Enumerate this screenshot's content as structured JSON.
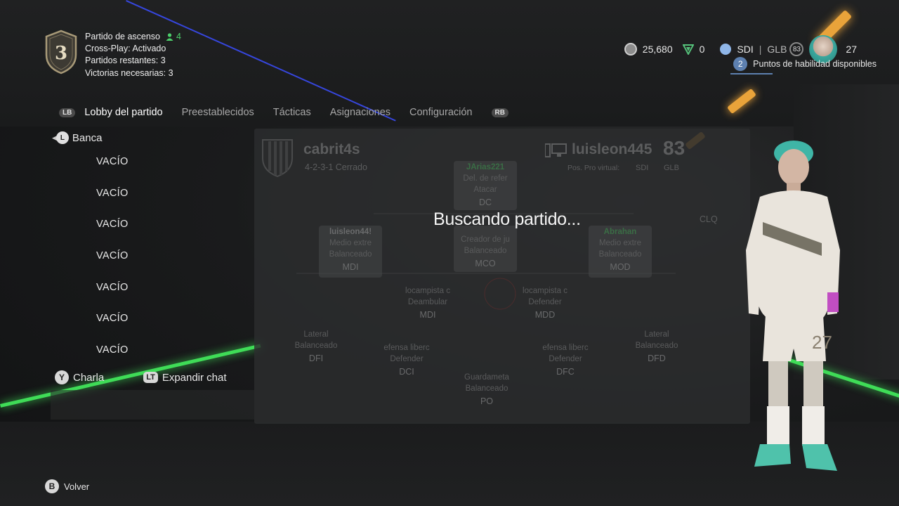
{
  "header": {
    "mode": "Partido de ascenso",
    "players_count": "4",
    "crossplay": "Cross-Play: Activado",
    "matches_left": "Partidos restantes: 3",
    "wins_needed": "Victorias necesarias: 3",
    "division_badge": "3"
  },
  "wallet": {
    "coins": "25,680",
    "points": "0",
    "region": "SDI",
    "glb_label": "GLB",
    "ovr_badge": "83",
    "level": "27",
    "skill_points_badge": "2",
    "skill_points_text": "Puntos de habilidad disponibles"
  },
  "tabs": {
    "left_button": "LB",
    "right_button": "RB",
    "items": [
      "Lobby del partido",
      "Preestablecidos",
      "Tácticas",
      "Asignaciones",
      "Configuración"
    ]
  },
  "bench": {
    "stick": "L",
    "title": "Banca",
    "slots": [
      "VACÍO",
      "VACÍO",
      "VACÍO",
      "VACÍO",
      "VACÍO",
      "VACÍO",
      "VACÍO"
    ]
  },
  "chat": {
    "chat_button": "Y",
    "chat_label": "Charla",
    "expand_button": "LT",
    "expand_label": "Expandir chat"
  },
  "pitch": {
    "home_team": "cabrit4s",
    "formation": "4-2-3-1 Cerrado",
    "away_team": "luisleon445",
    "rating": "83",
    "provirt_label": "Pos. Pro virtual:",
    "provirt_value": "SDI",
    "glb": "GLB",
    "clq": "CLQ",
    "status": "Buscando partido..."
  },
  "positions": [
    {
      "name": "JArias221",
      "role": "Del. de refer",
      "style": "Atacar",
      "code": "DC"
    },
    {
      "name": "luisleon44!",
      "role": "Medio extre",
      "style": "Balanceado",
      "code": "MDI"
    },
    {
      "name": "",
      "role": "Creador de ju",
      "style": "Balanceado",
      "code": "MCO"
    },
    {
      "name": "Abrahan",
      "role": "Medio extre",
      "style": "Balanceado",
      "code": "MOD"
    },
    {
      "name": "",
      "role": "locampista c",
      "style": "Deambular",
      "code": "MDI"
    },
    {
      "name": "",
      "role": "locampista c",
      "style": "Defender",
      "code": "MDD"
    },
    {
      "name": "",
      "role": "Lateral",
      "style": "Balanceado",
      "code": "DFI"
    },
    {
      "name": "",
      "role": "efensa liberc",
      "style": "Defender",
      "code": "DCI"
    },
    {
      "name": "",
      "role": "efensa liberc",
      "style": "Defender",
      "code": "DFC"
    },
    {
      "name": "",
      "role": "Lateral",
      "style": "Balanceado",
      "code": "DFD"
    },
    {
      "name": "",
      "role": "Guardameta",
      "style": "Balanceado",
      "code": "PO"
    }
  ],
  "footer": {
    "back_button": "B",
    "back_label": "Volver"
  },
  "colors": {
    "accent_green": "#4ccf6b",
    "neon_green": "#3fdc57",
    "neon_orange": "#e9a33a",
    "skill_blue": "#5d80b0"
  }
}
